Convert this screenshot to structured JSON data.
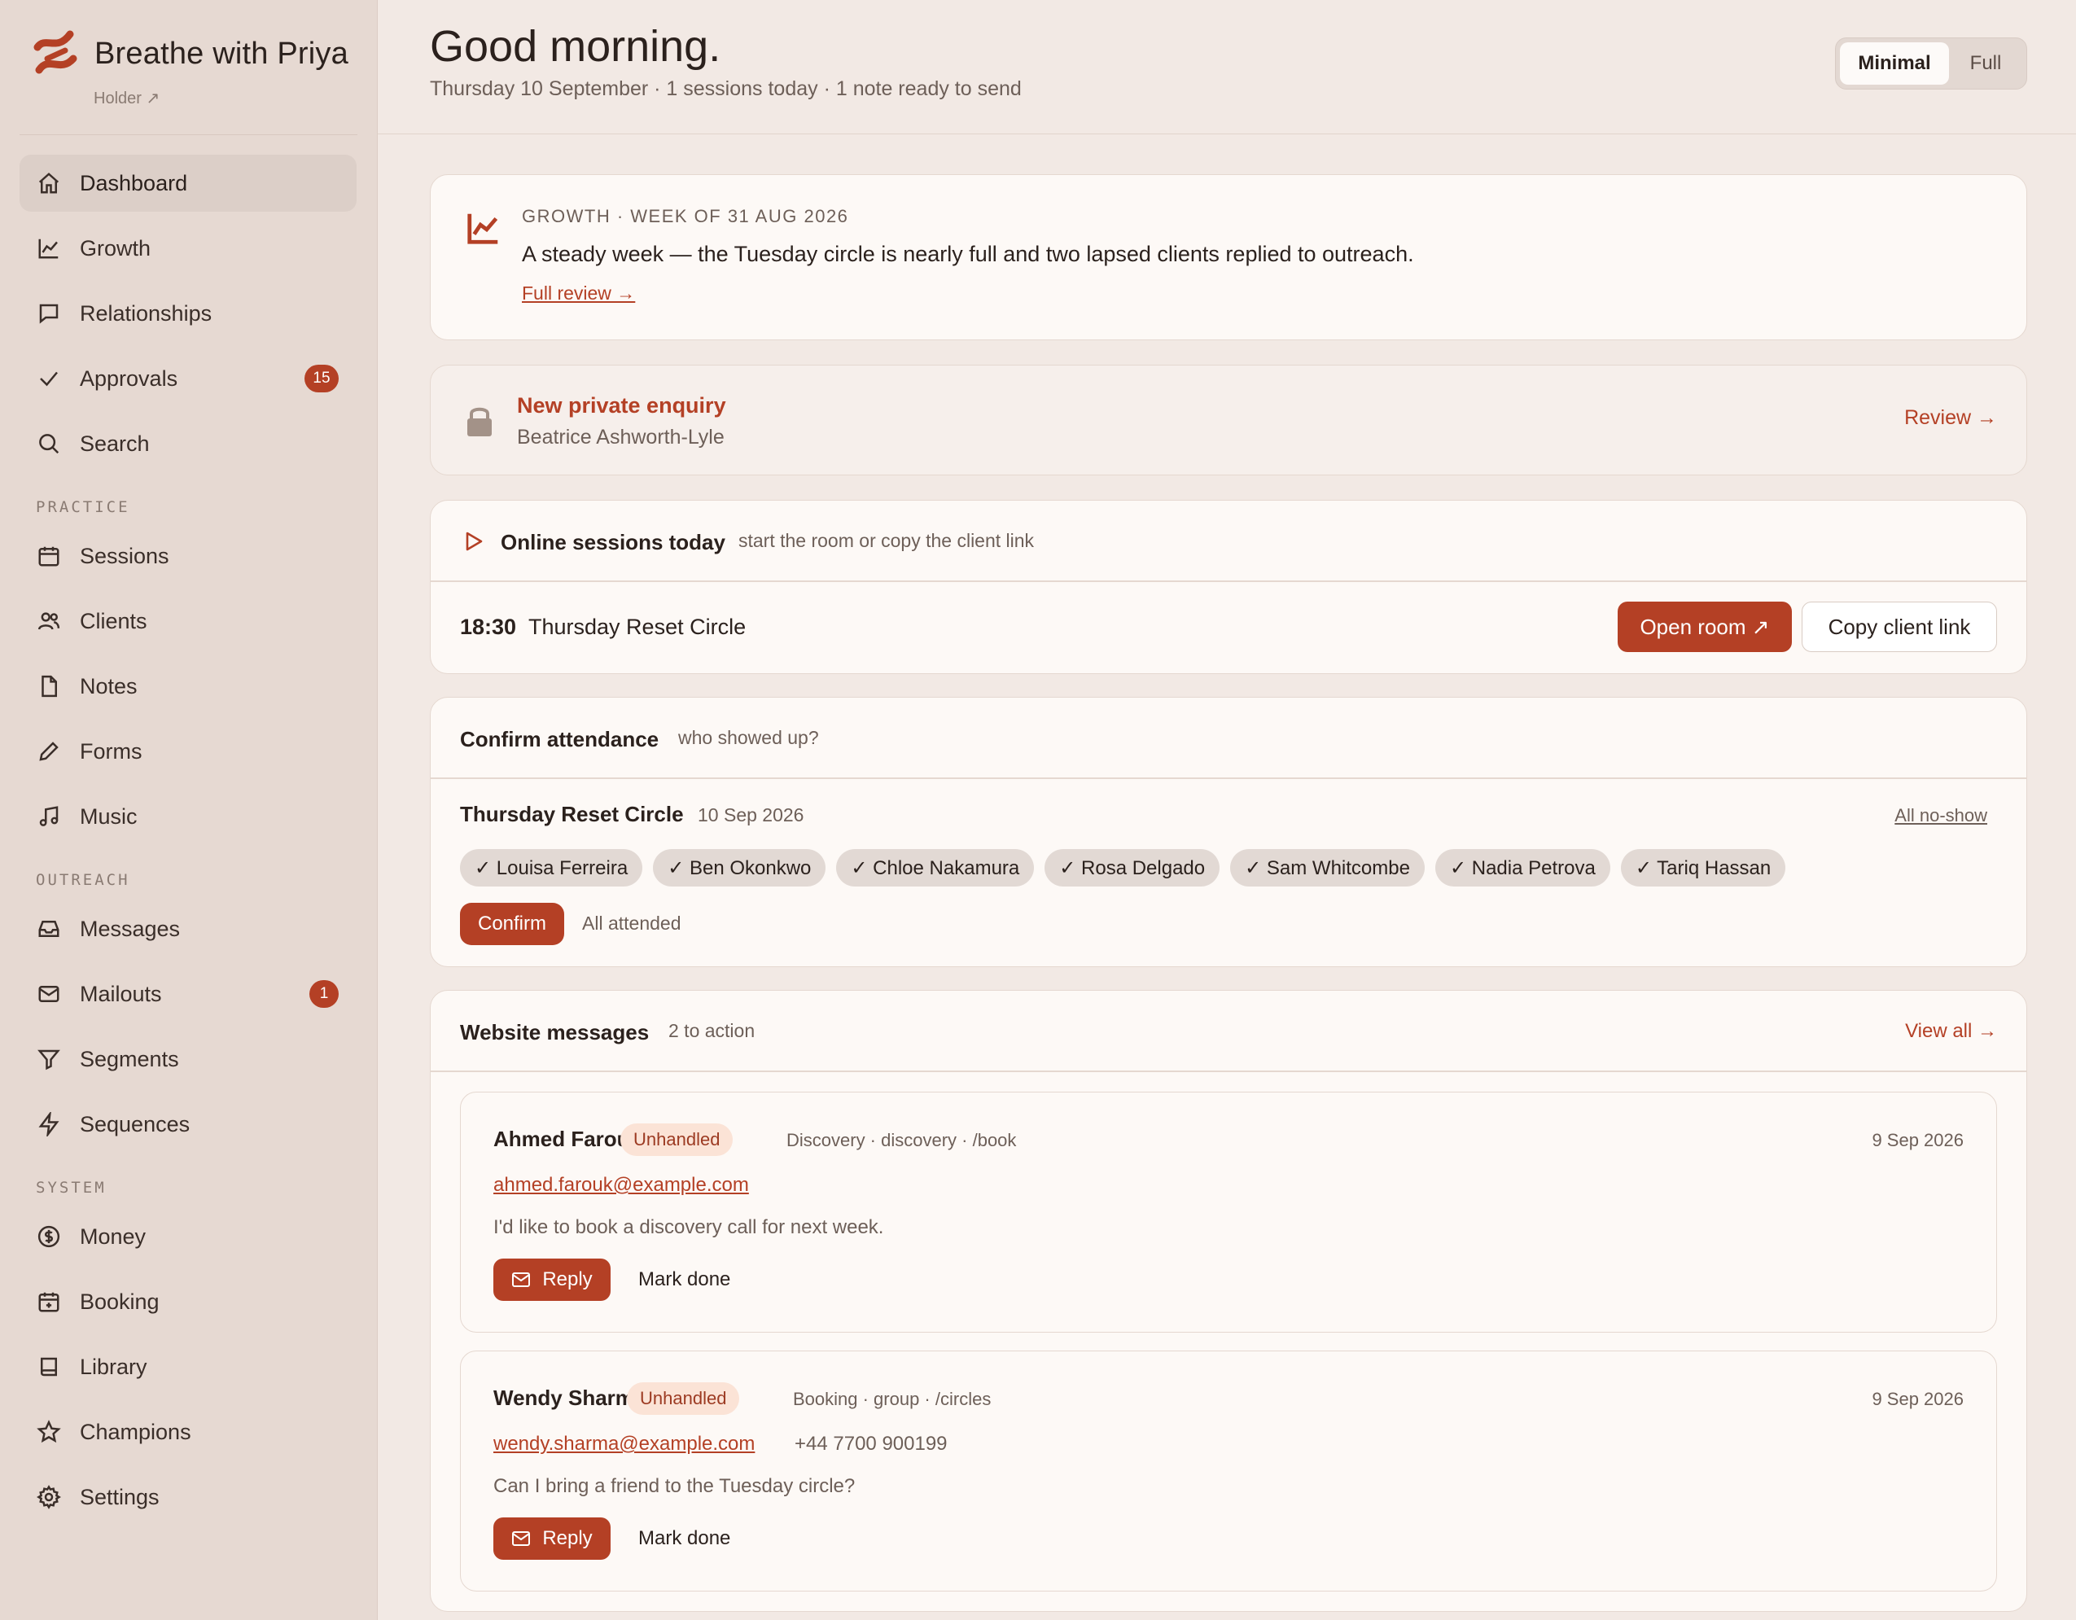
{
  "brand": {
    "name": "Breathe with Priya",
    "holder": "Holder ↗",
    "accent": "#b44025"
  },
  "sidebar": {
    "main": [
      {
        "label": "Dashboard",
        "icon": "home-icon",
        "active": true
      },
      {
        "label": "Growth",
        "icon": "chart-icon"
      },
      {
        "label": "Relationships",
        "icon": "chat-icon"
      },
      {
        "label": "Approvals",
        "icon": "check-icon",
        "badge": "15"
      },
      {
        "label": "Search",
        "icon": "search-icon"
      }
    ],
    "practice_title": "PRACTICE",
    "practice": [
      {
        "label": "Sessions",
        "icon": "calendar-icon"
      },
      {
        "label": "Clients",
        "icon": "users-icon"
      },
      {
        "label": "Notes",
        "icon": "file-icon"
      },
      {
        "label": "Forms",
        "icon": "pencil-icon"
      },
      {
        "label": "Music",
        "icon": "music-icon"
      }
    ],
    "outreach_title": "OUTREACH",
    "outreach": [
      {
        "label": "Messages",
        "icon": "inbox-icon"
      },
      {
        "label": "Mailouts",
        "icon": "mail-icon",
        "badge": "1"
      },
      {
        "label": "Segments",
        "icon": "filter-icon"
      },
      {
        "label": "Sequences",
        "icon": "bolt-icon"
      }
    ],
    "system_title": "SYSTEM",
    "system": [
      {
        "label": "Money",
        "icon": "dollar-icon"
      },
      {
        "label": "Booking",
        "icon": "calendar-plus-icon"
      },
      {
        "label": "Library",
        "icon": "book-icon"
      },
      {
        "label": "Champions",
        "icon": "star-icon"
      },
      {
        "label": "Settings",
        "icon": "gear-icon"
      }
    ]
  },
  "header": {
    "greeting": "Good morning.",
    "subline": "Thursday 10 September · 1 sessions today · 1 note ready to send",
    "toggle_minimal": "Minimal",
    "toggle_full": "Full"
  },
  "growth": {
    "eyebrow": "GROWTH · WEEK OF 31 AUG 2026",
    "summary": "A steady week — the Tuesday circle is nearly full and two lapsed clients replied to outreach.",
    "link": "Full review →"
  },
  "enquiry": {
    "title": "New private enquiry",
    "name": "Beatrice Ashworth-Lyle",
    "action": "Review →"
  },
  "online": {
    "title": "Online sessions today",
    "hint": "start the room or copy the client link",
    "time": "18:30",
    "session": "Thursday Reset Circle",
    "open_room": "Open room ↗",
    "copy_link": "Copy client link"
  },
  "attendance": {
    "title": "Confirm attendance",
    "hint": "who showed up?",
    "session": "Thursday Reset Circle",
    "date": "10 Sep 2026",
    "all_no_show": "All no-show",
    "attendees": [
      "✓ Louisa Ferreira",
      "✓ Ben Okonkwo",
      "✓ Chloe Nakamura",
      "✓ Rosa Delgado",
      "✓ Sam Whitcombe",
      "✓ Nadia Petrova",
      "✓ Tariq Hassan"
    ],
    "confirm": "Confirm",
    "status": "All attended"
  },
  "website": {
    "title": "Website messages",
    "count": "2 to action",
    "view_all": "View all →",
    "messages": [
      {
        "name": "Ahmed Farouk",
        "status": "Unhandled",
        "meta": "Discovery · discovery · /book",
        "date": "9 Sep 2026",
        "email": "ahmed.farouk@example.com",
        "phone": "",
        "body": "I'd like to book a discovery call for next week.",
        "reply": "Reply",
        "done": "Mark done"
      },
      {
        "name": "Wendy Sharma",
        "status": "Unhandled",
        "meta": "Booking · group · /circles",
        "date": "9 Sep 2026",
        "email": "wendy.sharma@example.com",
        "phone": "+44 7700 900199",
        "body": "Can I bring a friend to the Tuesday circle?",
        "reply": "Reply",
        "done": "Mark done"
      }
    ]
  }
}
